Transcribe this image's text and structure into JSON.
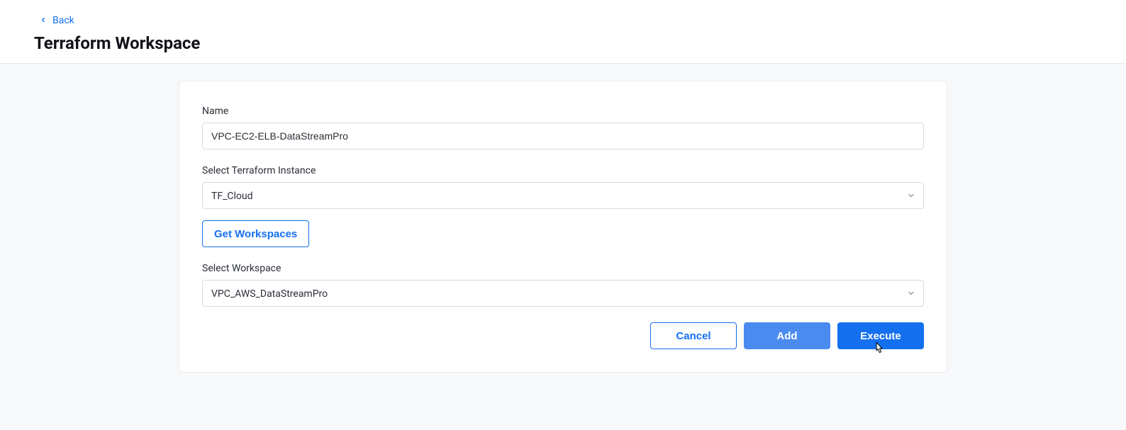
{
  "header": {
    "back_label": "Back",
    "page_title": "Terraform Workspace"
  },
  "form": {
    "name_label": "Name",
    "name_value": "VPC-EC2-ELB-DataStreamPro",
    "instance_label": "Select Terraform Instance",
    "instance_value": "TF_Cloud",
    "get_workspaces_label": "Get Workspaces",
    "workspace_label": "Select Workspace",
    "workspace_value": "VPC_AWS_DataStreamPro"
  },
  "actions": {
    "cancel": "Cancel",
    "add": "Add",
    "execute": "Execute"
  }
}
